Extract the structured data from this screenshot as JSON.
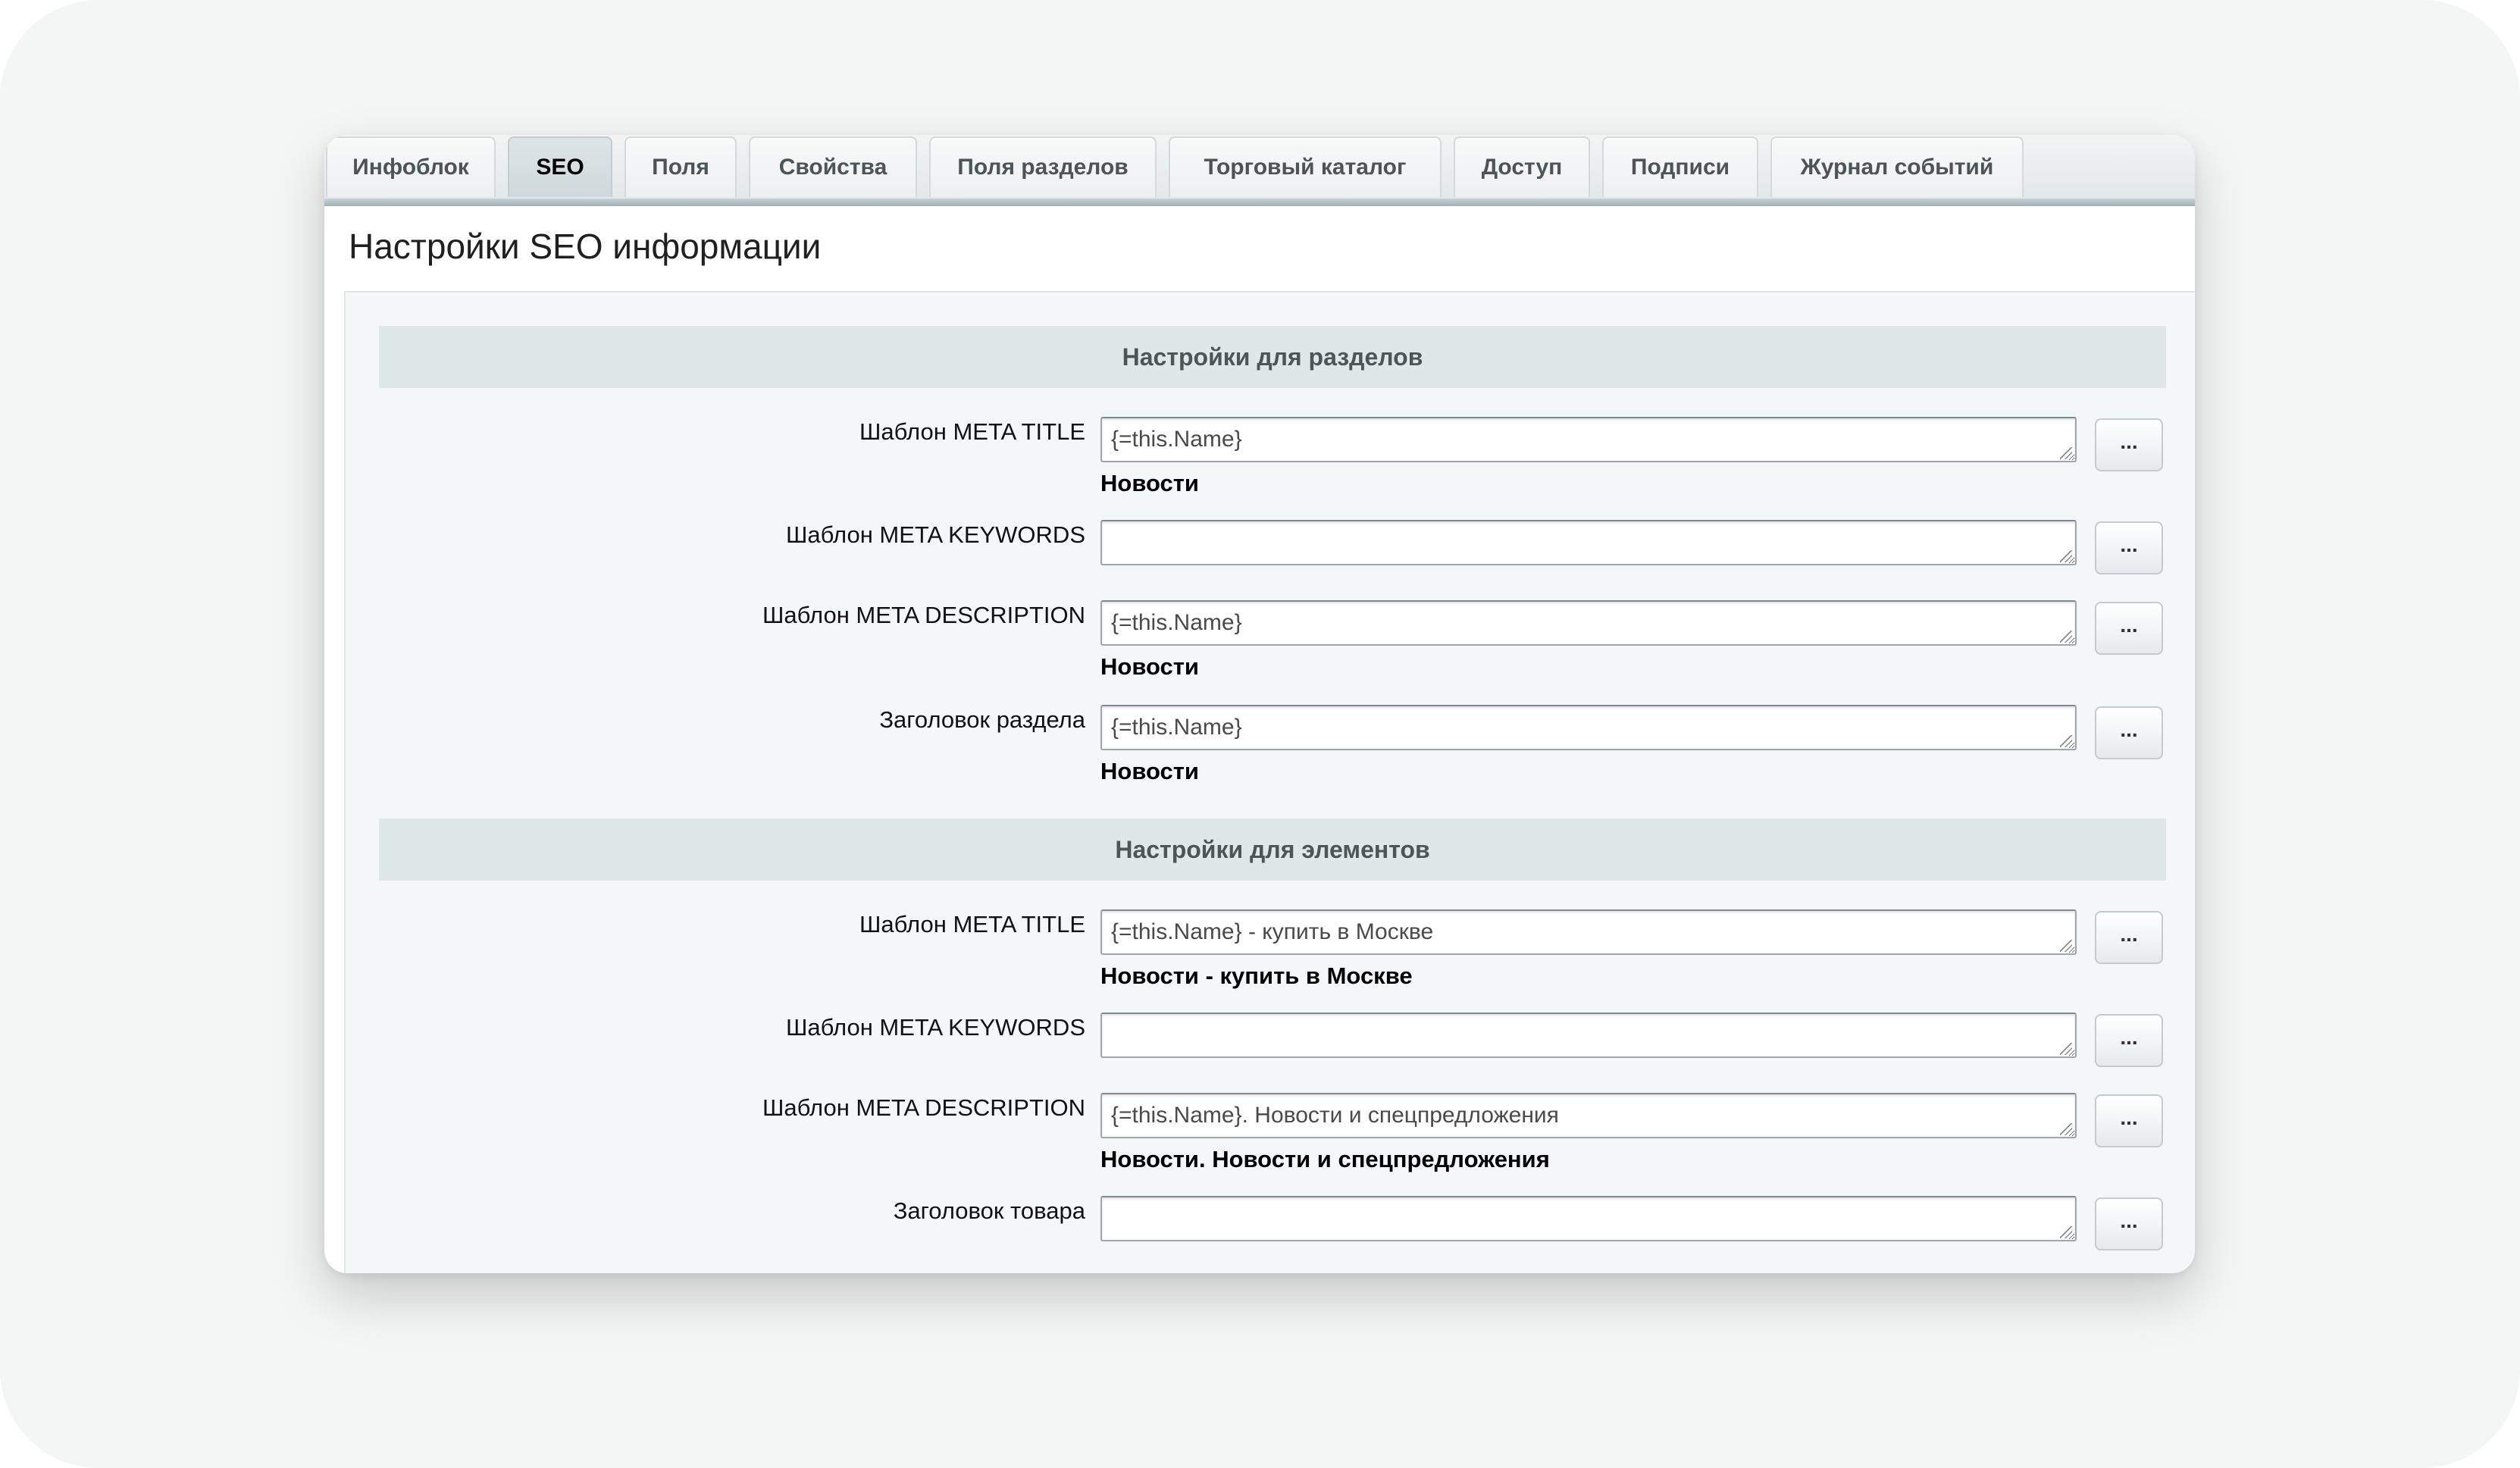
{
  "tabs": [
    {
      "label": "Инфоблок"
    },
    {
      "label": "SEO"
    },
    {
      "label": "Поля"
    },
    {
      "label": "Свойства"
    },
    {
      "label": "Поля разделов"
    },
    {
      "label": "Торговый каталог"
    },
    {
      "label": "Доступ"
    },
    {
      "label": "Подписи"
    },
    {
      "label": "Журнал событий"
    }
  ],
  "active_tab": "SEO",
  "page_title": "Настройки SEO информации",
  "sections": [
    {
      "header": "Настройки для разделов",
      "rows": [
        {
          "label": "Шаблон META TITLE",
          "value": "{=this.Name}",
          "preview": "Новости",
          "button": "..."
        },
        {
          "label": "Шаблон META KEYWORDS",
          "value": "",
          "preview": "",
          "button": "..."
        },
        {
          "label": "Шаблон META DESCRIPTION",
          "value": "{=this.Name}",
          "preview": "Новости",
          "button": "..."
        },
        {
          "label": "Заголовок раздела",
          "value": "{=this.Name}",
          "preview": "Новости",
          "button": "..."
        }
      ]
    },
    {
      "header": "Настройки для элементов",
      "rows": [
        {
          "label": "Шаблон META TITLE",
          "value": "{=this.Name} - купить в Москве",
          "preview": "Новости - купить в Москве",
          "button": "..."
        },
        {
          "label": "Шаблон META KEYWORDS",
          "value": "",
          "preview": "",
          "button": "..."
        },
        {
          "label": "Шаблон META DESCRIPTION",
          "value": "{=this.Name}. Новости и спецпредложения",
          "preview": "Новости. Новости и спецпредложения",
          "button": "..."
        },
        {
          "label": "Заголовок товара",
          "value": "",
          "preview": "",
          "button": "..."
        }
      ]
    }
  ],
  "colors": {
    "active_tab_bg": "#cfd8db",
    "section_header_bg": "#e0e7e9",
    "content_bg": "#f4f7f8"
  }
}
